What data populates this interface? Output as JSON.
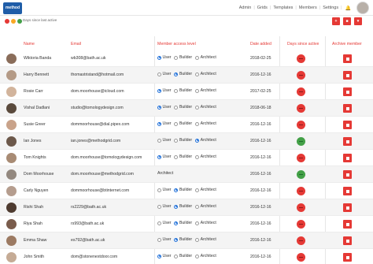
{
  "app": {
    "logo_text": "method"
  },
  "nav": {
    "items": [
      "Admin",
      "Grids",
      "Templates",
      "Members",
      "Settings"
    ]
  },
  "subbar": {
    "title": "Days since last active",
    "dots": [
      "#e53935",
      "#f9a825",
      "#43a047"
    ]
  },
  "colors": {
    "accent": "#e53935",
    "inactive": "#e53935",
    "active": "#43a047",
    "radio": "#1e6fd9"
  },
  "table": {
    "headers": {
      "name": "Name",
      "email": "Email",
      "access": "Member access level",
      "date": "Date added",
      "days": "Days since active",
      "archive": "Archive member"
    },
    "access_options": {
      "user": "User",
      "builder": "Builder",
      "architect": "Architect"
    },
    "rows": [
      {
        "name": "Wiktoria Banda",
        "email": "wb308@bath.ac.uk",
        "access": "user",
        "date": "2018-02-25",
        "active": false
      },
      {
        "name": "Harry Bennett",
        "email": "thomastristand@hotmail.com",
        "access": "builder",
        "date": "2016-12-16",
        "active": false
      },
      {
        "name": "Rosie Carr",
        "email": "dom.moorhouse@icloud.com",
        "access": "user",
        "date": "2017-02-25",
        "active": false
      },
      {
        "name": "Vishal Dadlani",
        "email": "studio@tomologydesign.com",
        "access": "user",
        "date": "2018-06-18",
        "active": false
      },
      {
        "name": "Susie Greer",
        "email": "dommoorhouse@dial.pipex.com",
        "access": "user",
        "date": "2016-12-16",
        "active": false
      },
      {
        "name": "Ian Jones",
        "email": "ian.jones@methodgrid.com",
        "access": "architect",
        "date": "2016-12-16",
        "active": true
      },
      {
        "name": "Tom Knights",
        "email": "dom.moorhouse@tomologydesign.com",
        "access": "user",
        "date": "2016-12-16",
        "active": false
      },
      {
        "name": "Dom Moorhouse",
        "email": "dom.moorhouse@methodgrid.com",
        "access": "architect_only",
        "date": "2016-12-16",
        "active": true
      },
      {
        "name": "Carly Nguyen",
        "email": "dommoorhouse@btinternet.com",
        "access": "builder",
        "date": "2016-12-16",
        "active": false
      },
      {
        "name": "Rishi Shah",
        "email": "rs2229@bath.ac.uk",
        "access": "builder",
        "date": "2016-12-16",
        "active": false
      },
      {
        "name": "Riya Shah",
        "email": "rs993@bath.ac.uk",
        "access": "builder",
        "date": "2016-12-16",
        "active": false
      },
      {
        "name": "Emma Shaw",
        "email": "es792@bath.ac.uk",
        "access": "builder",
        "date": "2016-12-16",
        "active": false
      },
      {
        "name": "John Smith",
        "email": "dom@stonenextdoor.com",
        "access": "user",
        "date": "2016-12-16",
        "active": false
      }
    ]
  }
}
